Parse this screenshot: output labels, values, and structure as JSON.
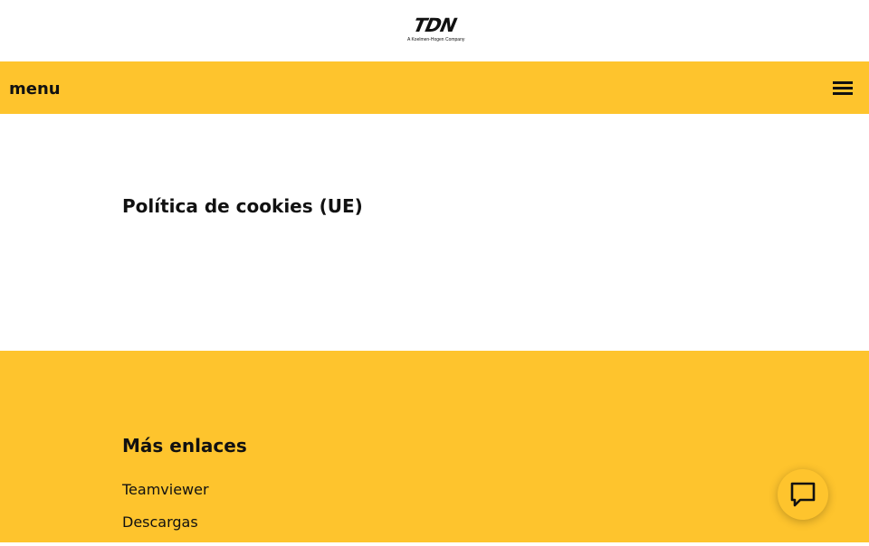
{
  "header": {
    "logo_text": "TDN",
    "logo_tagline": "A Koelmen-Hogen Company"
  },
  "nav": {
    "menu_label": "menu",
    "menu_icon": "hamburger-icon"
  },
  "main": {
    "title": "Política de cookies (UE)"
  },
  "footer": {
    "heading": "Más enlaces",
    "links": [
      {
        "label": "Teamviewer"
      },
      {
        "label": "Descargas"
      }
    ]
  },
  "chat": {
    "icon": "chat-bubble-icon"
  },
  "colors": {
    "brand_yellow": "#fec42d",
    "text": "#111111",
    "background": "#ffffff"
  }
}
